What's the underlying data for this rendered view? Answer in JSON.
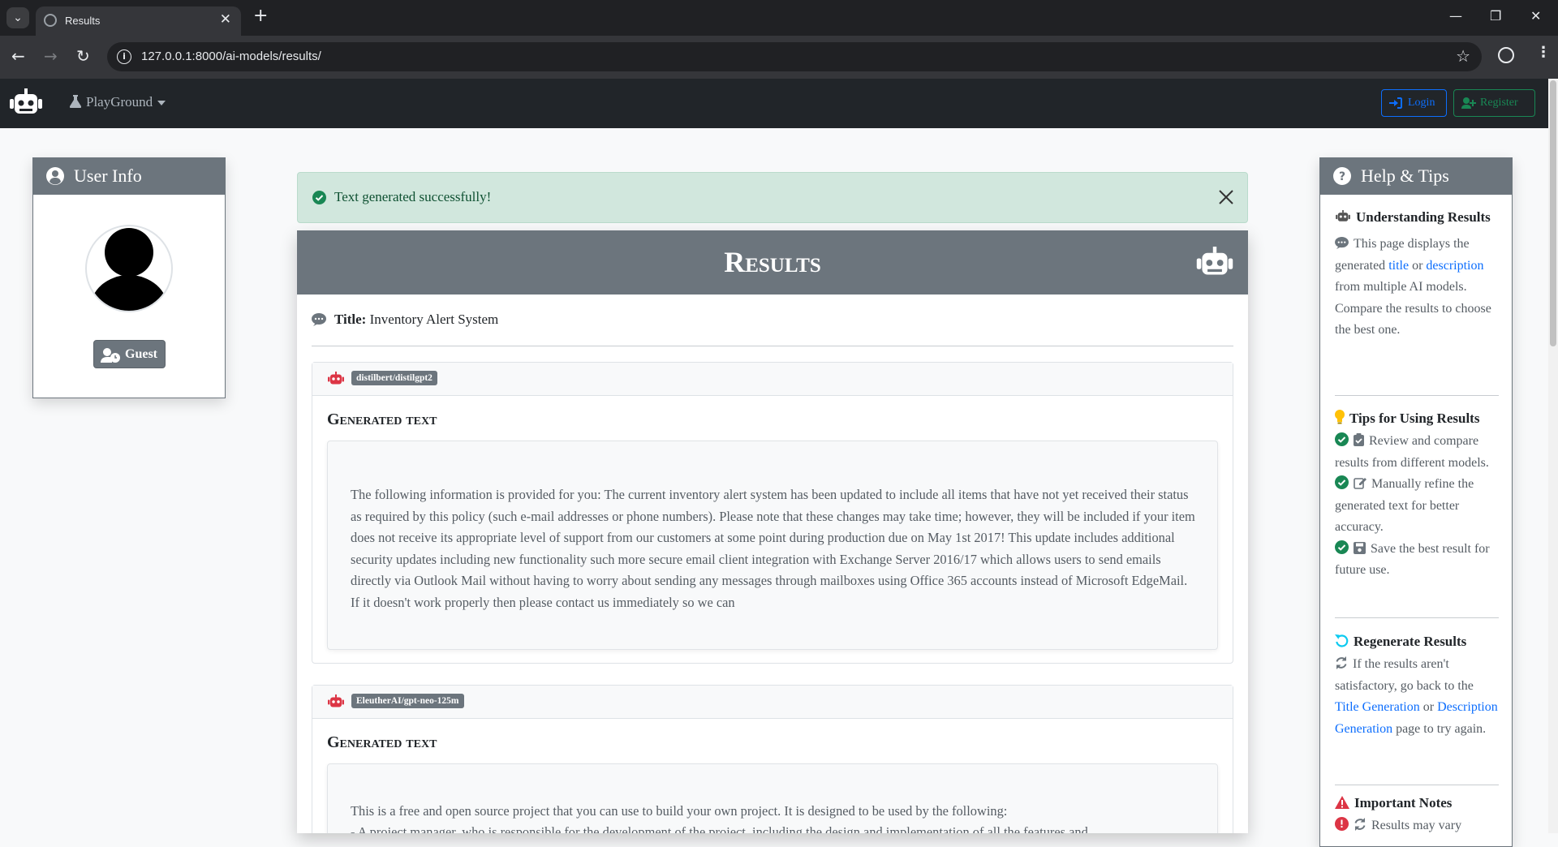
{
  "browser": {
    "tab_title": "Results",
    "url": "127.0.0.1:8000/ai-models/results/"
  },
  "navbar": {
    "menu_label": "PlayGround",
    "login_label": "Login",
    "register_label": "Register"
  },
  "user_info": {
    "title": "User Info",
    "guest_label": "Guest"
  },
  "alert": {
    "message": "Text generated successfully!"
  },
  "results": {
    "heading": "Results",
    "title_label": "Title:",
    "title_value": "Inventory Alert System",
    "models": [
      {
        "name": "distilbert/distilgpt2",
        "heading": "Generated text",
        "text": "The following information is provided for you: The current inventory alert system has been updated to include all items that have not yet received their status as required by this policy (such e-mail addresses or phone numbers). Please note that these changes may take time; however, they will be included if your item does not receive its appropriate level of support from our customers at some point during production due on May 1st 2017! This update includes additional security updates including new functionality such more secure email client integration with Exchange Server 2016/17 which allows users to send emails directly via Outlook Mail without having to worry about sending any messages through mailboxes using Office 365 accounts instead of Microsoft EdgeMail. If it doesn't work properly then please contact us immediately so we can"
      },
      {
        "name": "EleutherAI/gpt-neo-125m",
        "heading": "Generated text",
        "text": "This is a free and open source project that you can use to build your own project. It is designed to be used by the following:",
        "text2": "- A project manager, who is responsible for the development of the project, including the design and implementation of all the features and"
      }
    ]
  },
  "help": {
    "title": "Help & Tips",
    "s1_title": "Understanding Results",
    "s1_text_a": "This page displays the generated ",
    "s1_link1": "title",
    "s1_text_b": " or ",
    "s1_link2": "description",
    "s1_text_c": " from multiple AI models. Compare the results to choose the best one.",
    "s2_title": "Tips for Using Results",
    "tip1": "Review and compare results from different models.",
    "tip2": "Manually refine the generated text for better accuracy.",
    "tip3": "Save the best result for future use.",
    "s3_title": "Regenerate Results",
    "s3_text_a": "If the results aren't satisfactory, go back to the ",
    "s3_link1": "Title Generation",
    "s3_text_b": " or ",
    "s3_link2": "Description Generation",
    "s3_text_c": " page to try again.",
    "s4_title": "Important Notes",
    "note1": "Results may vary"
  },
  "colors": {
    "success": "#198754",
    "danger": "#dc3545",
    "secondary": "#6c757d",
    "warning": "#ffc107",
    "info": "#0dcaf0",
    "primary": "#0d6efd"
  }
}
